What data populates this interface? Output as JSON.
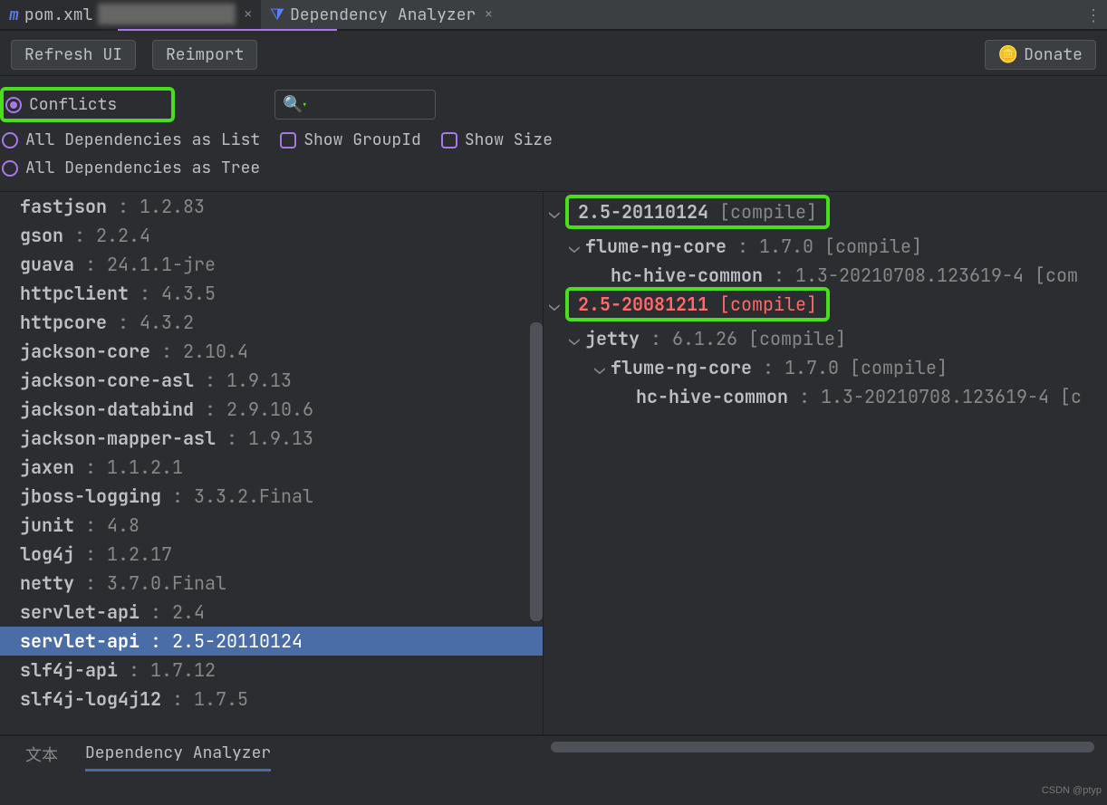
{
  "tabs": {
    "pom": {
      "icon": "m",
      "file": "pom.xml",
      "obscured": "██████████████"
    },
    "analyzer": {
      "title": "Dependency Analyzer"
    }
  },
  "toolbar": {
    "refresh": "Refresh UI",
    "reimport": "Reimport",
    "donate": "Donate"
  },
  "filters": {
    "conflicts": "Conflicts",
    "all_list": "All Dependencies as List",
    "all_tree": "All Dependencies as Tree",
    "show_groupid": "Show GroupId",
    "show_size": "Show Size"
  },
  "deps": [
    {
      "name": "fastjson",
      "ver": "1.2.83"
    },
    {
      "name": "gson",
      "ver": "2.2.4"
    },
    {
      "name": "guava",
      "ver": "24.1.1-jre"
    },
    {
      "name": "httpclient",
      "ver": "4.3.5"
    },
    {
      "name": "httpcore",
      "ver": "4.3.2"
    },
    {
      "name": "jackson-core",
      "ver": "2.10.4"
    },
    {
      "name": "jackson-core-asl",
      "ver": "1.9.13"
    },
    {
      "name": "jackson-databind",
      "ver": "2.9.10.6"
    },
    {
      "name": "jackson-mapper-asl",
      "ver": "1.9.13"
    },
    {
      "name": "jaxen",
      "ver": "1.1.2.1"
    },
    {
      "name": "jboss-logging",
      "ver": "3.3.2.Final"
    },
    {
      "name": "junit",
      "ver": "4.8"
    },
    {
      "name": "log4j",
      "ver": "1.2.17"
    },
    {
      "name": "netty",
      "ver": "3.7.0.Final"
    },
    {
      "name": "servlet-api",
      "ver": "2.4"
    },
    {
      "name": "servlet-api",
      "ver": "2.5-20110124",
      "selected": true
    },
    {
      "name": "slf4j-api",
      "ver": "1.7.12"
    },
    {
      "name": "slf4j-log4j12",
      "ver": "1.7.5"
    }
  ],
  "tree": {
    "r0": {
      "ver": "2.5-20110124",
      "scope": "[compile]"
    },
    "r1": {
      "name": "flume-ng-core",
      "ver": "1.7.0",
      "scope": "[compile]"
    },
    "r2": {
      "name": "hc-hive-common",
      "ver": "1.3-20210708.123619-4",
      "scope": "[com"
    },
    "r3": {
      "ver": "2.5-20081211",
      "scope": "[compile]"
    },
    "r4": {
      "name": "jetty",
      "ver": "6.1.26",
      "scope": "[compile]"
    },
    "r5": {
      "name": "flume-ng-core",
      "ver": "1.7.0",
      "scope": "[compile]"
    },
    "r6": {
      "name": "hc-hive-common",
      "ver": "1.3-20210708.123619-4",
      "scope": "[c"
    }
  },
  "bottom": {
    "text_tab": "文本",
    "analyzer_tab": "Dependency Analyzer"
  },
  "watermark": "CSDN @ptyp"
}
